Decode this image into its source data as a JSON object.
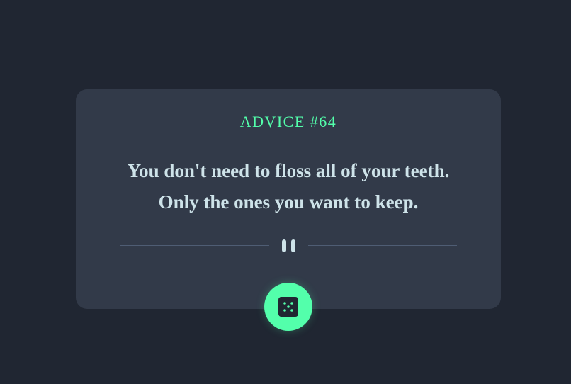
{
  "advice": {
    "id_label": "ADVICE #64",
    "text_line1": "You don't need to floss all of your teeth.",
    "text_line2": "Only the ones you want to keep."
  },
  "icons": {
    "divider": "pause-icon",
    "button": "dice-icon"
  },
  "colors": {
    "background": "#202632",
    "card": "#323a49",
    "accent": "#53ffab",
    "text": "#cee3e9",
    "divider_line": "#4f5d74"
  }
}
